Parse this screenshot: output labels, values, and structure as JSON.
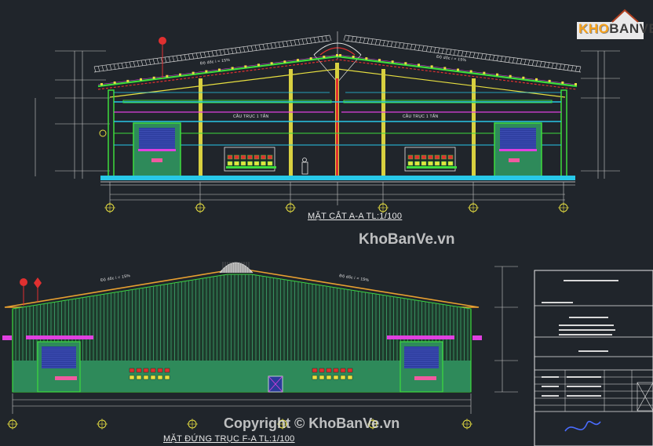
{
  "logo": {
    "text_a": "KHO",
    "text_b": "BANVE"
  },
  "watermarks": {
    "center": "KhoBanVe.vn",
    "bottom": "Copyright © KhoBanVe.vn"
  },
  "section": {
    "title": "MẶT CẮT A-A  TL:1/100",
    "crane_label": "CẦU TRỤC 1 TẤN",
    "slope_label": "Độ dốc i = 15%"
  },
  "elevation": {
    "title": "MẶT ĐỨNG TRỤC F-A  TL:1/100",
    "slope_label": "Độ dốc i = 15%"
  },
  "colors": {
    "background": "#20252b",
    "dim_line": "#c8c8c8",
    "roof_red": "#e03030",
    "green": "#3ddc3d",
    "cyan": "#28c8e8",
    "yellow": "#e8e040",
    "magenta": "#e040e0",
    "wall_green": "#2e8a5a",
    "door_blue": "#2a3a9a"
  }
}
